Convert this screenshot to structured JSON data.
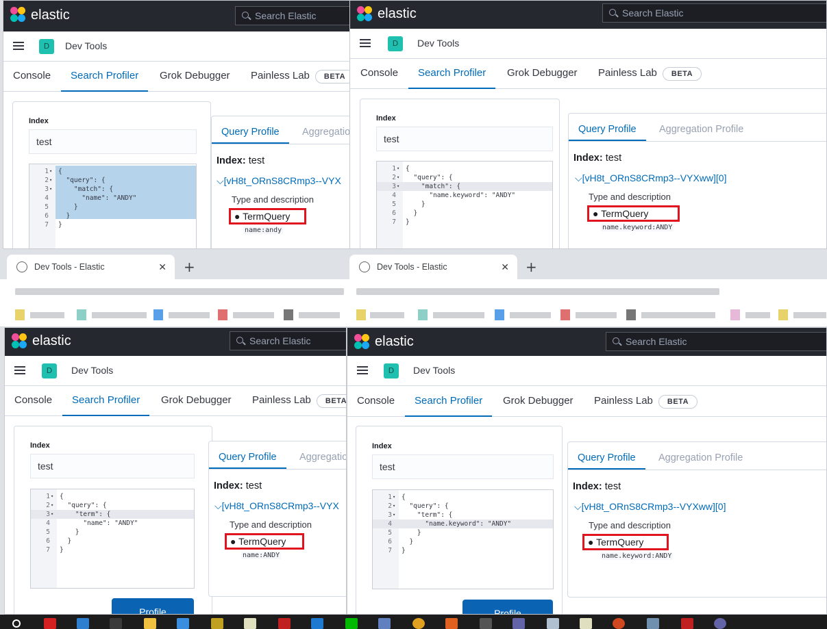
{
  "brand": "elastic",
  "search_placeholder": "Search Elastic",
  "avatar_initial": "D",
  "app_title": "Dev Tools",
  "tabs": [
    "Console",
    "Search Profiler",
    "Grok Debugger",
    "Painless Lab"
  ],
  "beta_badge": "BETA",
  "index_label": "Index",
  "index_value": "test",
  "result_tabs": {
    "query": "Query Profile",
    "aggregation_full": "Aggregation Profile",
    "aggregation_cut": "Aggregatio",
    "aggregation_cut2": "Aggregatio"
  },
  "index_heading_label": "Index:",
  "index_heading_value": "test",
  "shard_full": "[vH8t_ORnS8CRmp3--VYXww][0]",
  "shard_cut": "[vH8t_ORnS8CRmp3--VYX",
  "type_desc_label": "Type and description",
  "query_type": "TermQuery",
  "descriptions": {
    "tl": "name:andy",
    "tr": "name.keyword:ANDY",
    "bl": "name:ANDY",
    "br": "name.keyword:ANDY"
  },
  "profile_button": "Profile",
  "browser_tab_title": "Dev Tools - Elastic",
  "editors": {
    "tl": [
      {
        "n": "1",
        "f": "▾",
        "t": "{"
      },
      {
        "n": "2",
        "f": "▾",
        "t": "  \"query\": {"
      },
      {
        "n": "3",
        "f": "▾",
        "t": "    \"match\": {"
      },
      {
        "n": "4",
        "f": "",
        "t": "      \"name\": \"ANDY\""
      },
      {
        "n": "5",
        "f": "",
        "t": "    }"
      },
      {
        "n": "6",
        "f": "",
        "t": "  }"
      },
      {
        "n": "7",
        "f": "",
        "t": "}"
      }
    ],
    "tr": [
      {
        "n": "1",
        "f": "▾",
        "t": "{"
      },
      {
        "n": "2",
        "f": "▾",
        "t": "  \"query\": {"
      },
      {
        "n": "3",
        "f": "▾",
        "t": "    \"match\": {"
      },
      {
        "n": "4",
        "f": "",
        "t": "      \"name.keyword\": \"ANDY\""
      },
      {
        "n": "5",
        "f": "",
        "t": "    }"
      },
      {
        "n": "6",
        "f": "",
        "t": "  }"
      },
      {
        "n": "7",
        "f": "",
        "t": "}"
      }
    ],
    "bl": [
      {
        "n": "1",
        "f": "▾",
        "t": "{"
      },
      {
        "n": "2",
        "f": "▾",
        "t": "  \"query\": {"
      },
      {
        "n": "3",
        "f": "▾",
        "t": "    \"term\": {"
      },
      {
        "n": "4",
        "f": "",
        "t": "      \"name\": \"ANDY\""
      },
      {
        "n": "5",
        "f": "",
        "t": "    }"
      },
      {
        "n": "6",
        "f": "",
        "t": "  }"
      },
      {
        "n": "7",
        "f": "",
        "t": "}"
      }
    ],
    "br": [
      {
        "n": "1",
        "f": "▾",
        "t": "{"
      },
      {
        "n": "2",
        "f": "▾",
        "t": "  \"query\": {"
      },
      {
        "n": "3",
        "f": "▾",
        "t": "    \"term\": {"
      },
      {
        "n": "4",
        "f": "",
        "t": "      \"name.keyword\": \"ANDY\""
      },
      {
        "n": "5",
        "f": "",
        "t": "    }"
      },
      {
        "n": "6",
        "f": "",
        "t": "  }"
      },
      {
        "n": "7",
        "f": "",
        "t": "}"
      }
    ]
  },
  "colors": {
    "header_bg": "#25282f",
    "accent": "#006bb8",
    "highlight_box": "#e0141e",
    "button": "#0b64b3"
  }
}
